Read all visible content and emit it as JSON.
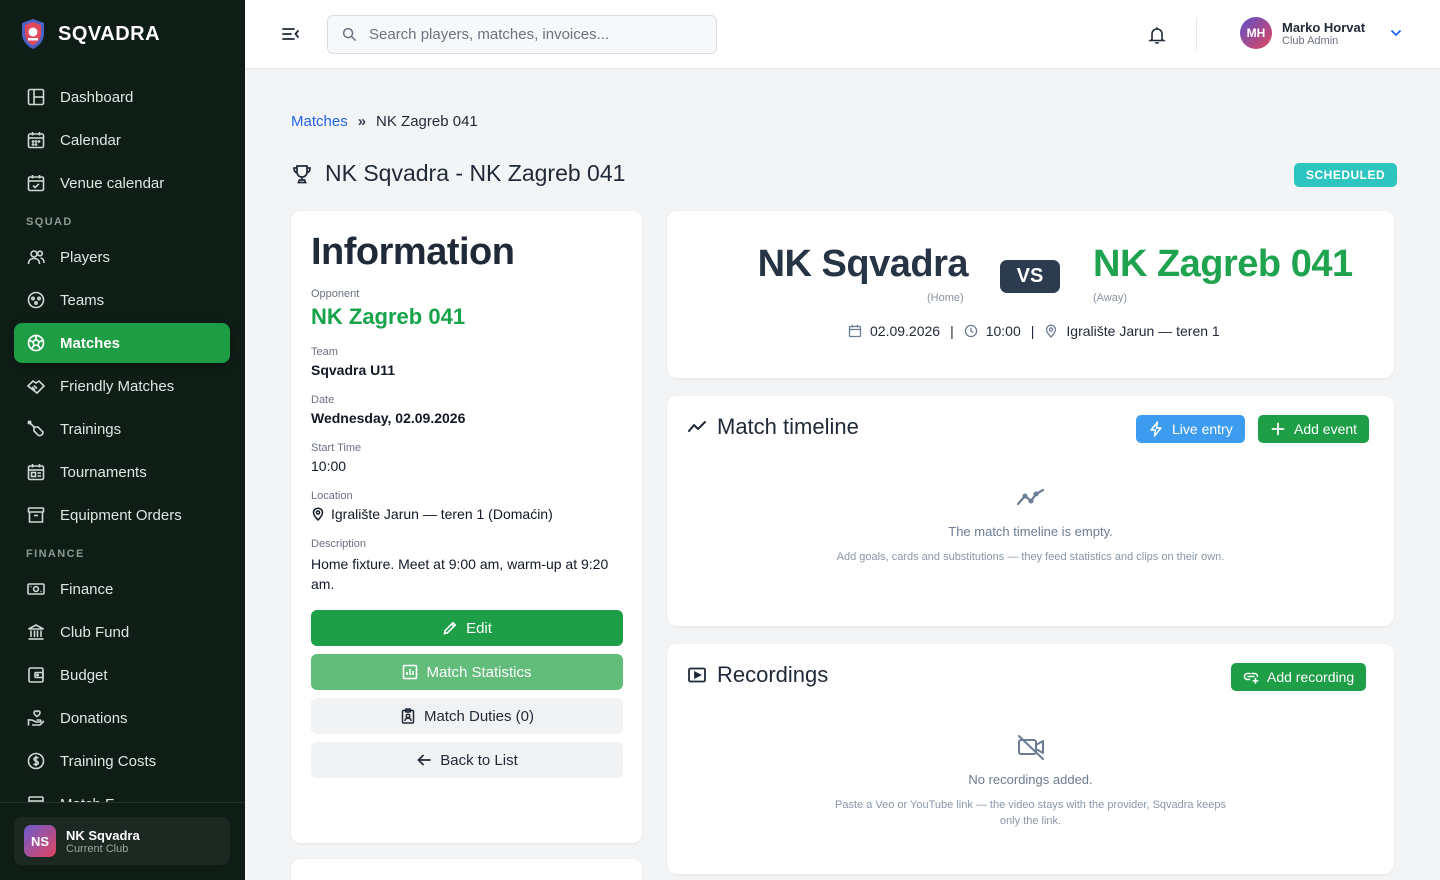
{
  "sidebar": {
    "brand": "SQVADRA",
    "items_top": [
      {
        "label": "Dashboard",
        "icon": "dashboard-icon"
      },
      {
        "label": "Calendar",
        "icon": "calendar-icon"
      },
      {
        "label": "Venue calendar",
        "icon": "calendar-check-icon"
      }
    ],
    "section_squad": "SQUAD",
    "items_squad": [
      {
        "label": "Players",
        "icon": "users-icon"
      },
      {
        "label": "Teams",
        "icon": "team-icon"
      },
      {
        "label": "Matches",
        "icon": "ball-icon",
        "active": true
      },
      {
        "label": "Friendly Matches",
        "icon": "handshake-icon"
      },
      {
        "label": "Trainings",
        "icon": "whistle-icon"
      },
      {
        "label": "Tournaments",
        "icon": "tournament-icon"
      },
      {
        "label": "Equipment Orders",
        "icon": "box-icon"
      }
    ],
    "section_finance": "FINANCE",
    "items_finance": [
      {
        "label": "Finance",
        "icon": "cash-icon"
      },
      {
        "label": "Club Fund",
        "icon": "bank-icon"
      },
      {
        "label": "Budget",
        "icon": "wallet-icon"
      },
      {
        "label": "Donations",
        "icon": "donation-icon"
      },
      {
        "label": "Training Costs",
        "icon": "coin-icon"
      },
      {
        "label": "Match F...",
        "icon": "receipt-icon"
      }
    ],
    "club": {
      "initials": "NS",
      "name": "NK Sqvadra",
      "sub": "Current Club"
    }
  },
  "header": {
    "search_placeholder": "Search players, matches, invoices...",
    "user": {
      "initials": "MH",
      "name": "Marko Horvat",
      "role": "Club Admin"
    }
  },
  "breadcrumb": {
    "parent": "Matches",
    "current": "NK Zagreb 041"
  },
  "page_title": "NK Sqvadra - NK Zagreb 041",
  "status": "SCHEDULED",
  "info": {
    "heading": "Information",
    "opponent_label": "Opponent",
    "opponent": "NK Zagreb 041",
    "team_label": "Team",
    "team": "Sqvadra U11",
    "date_label": "Date",
    "date": "Wednesday, 02.09.2026",
    "start_label": "Start Time",
    "start": "10:00",
    "location_label": "Location",
    "location": "Igralište Jarun — teren 1 (Domaćin)",
    "description_label": "Description",
    "description": "Home fixture. Meet at 9:00 am, warm-up at 9:20 am.",
    "edit": "Edit",
    "stats": "Match Statistics",
    "duties": "Match Duties (0)",
    "back": "Back to List"
  },
  "match": {
    "home": "NK Sqvadra",
    "home_sub": "(Home)",
    "vs": "VS",
    "away": "NK Zagreb 041",
    "away_sub": "(Away)",
    "date": "02.09.2026",
    "time": "10:00",
    "venue": "Igralište Jarun — teren 1"
  },
  "timeline": {
    "title": "Match timeline",
    "live_entry": "Live entry",
    "add_event": "Add event",
    "empty_title": "The match timeline is empty.",
    "empty_sub": "Add goals, cards and substitutions — they feed statistics and clips on their own."
  },
  "recordings": {
    "title": "Recordings",
    "add": "Add recording",
    "empty_title": "No recordings added.",
    "empty_sub": "Paste a Veo or YouTube link — the video stays with the provider, Sqvadra keeps only the link."
  },
  "colors": {
    "sidebar_bg": "#0f1d17",
    "accent_green": "#1e9e46",
    "status_teal": "#2ec4c0",
    "live_blue": "#3d9cf0"
  }
}
